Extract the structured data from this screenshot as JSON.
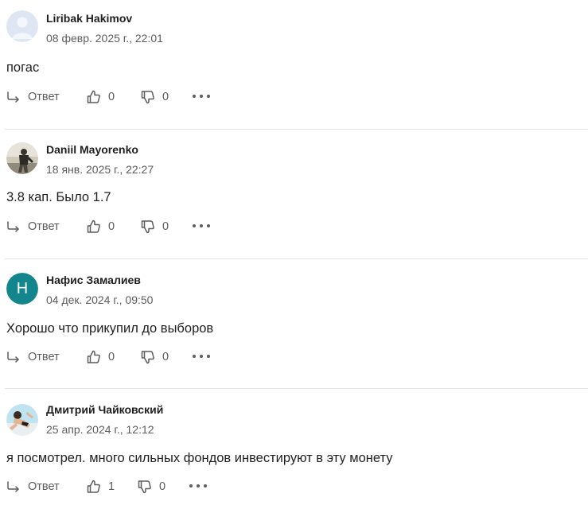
{
  "comments": [
    {
      "author": "Liribak Hakimov",
      "date": "08 февр. 2025 г., 22:01",
      "text": "погас",
      "reply_label": "Ответ",
      "likes": "0",
      "dislikes": "0",
      "avatar": {
        "kind": "placeholder-person-icon"
      }
    },
    {
      "author": "Daniil Mayorenko",
      "date": "18 янв. 2025 г., 22:27",
      "text": "3.8 кап. Было 1.7",
      "reply_label": "Ответ",
      "likes": "0",
      "dislikes": "0",
      "avatar": {
        "kind": "photo"
      }
    },
    {
      "author": "Нафис Замалиев",
      "date": "04 дек. 2024 г., 09:50",
      "text": "Хорошо что прикупил до выборов",
      "reply_label": "Ответ",
      "likes": "0",
      "dislikes": "0",
      "avatar": {
        "kind": "initial",
        "initial": "Н",
        "color": "#12868c"
      }
    },
    {
      "author": "Дмитрий Чайковский",
      "date": "25 апр. 2024 г., 12:12",
      "text": "я посмотрел. много сильных фондов инвестируют в эту монету",
      "reply_label": "Ответ",
      "likes": "1",
      "dislikes": "0",
      "avatar": {
        "kind": "photo"
      }
    }
  ],
  "icons": {
    "reply": "reply-arrow-icon",
    "like": "thumbs-up-icon",
    "dislike": "thumbs-down-icon",
    "more": "more-dots-icon"
  }
}
